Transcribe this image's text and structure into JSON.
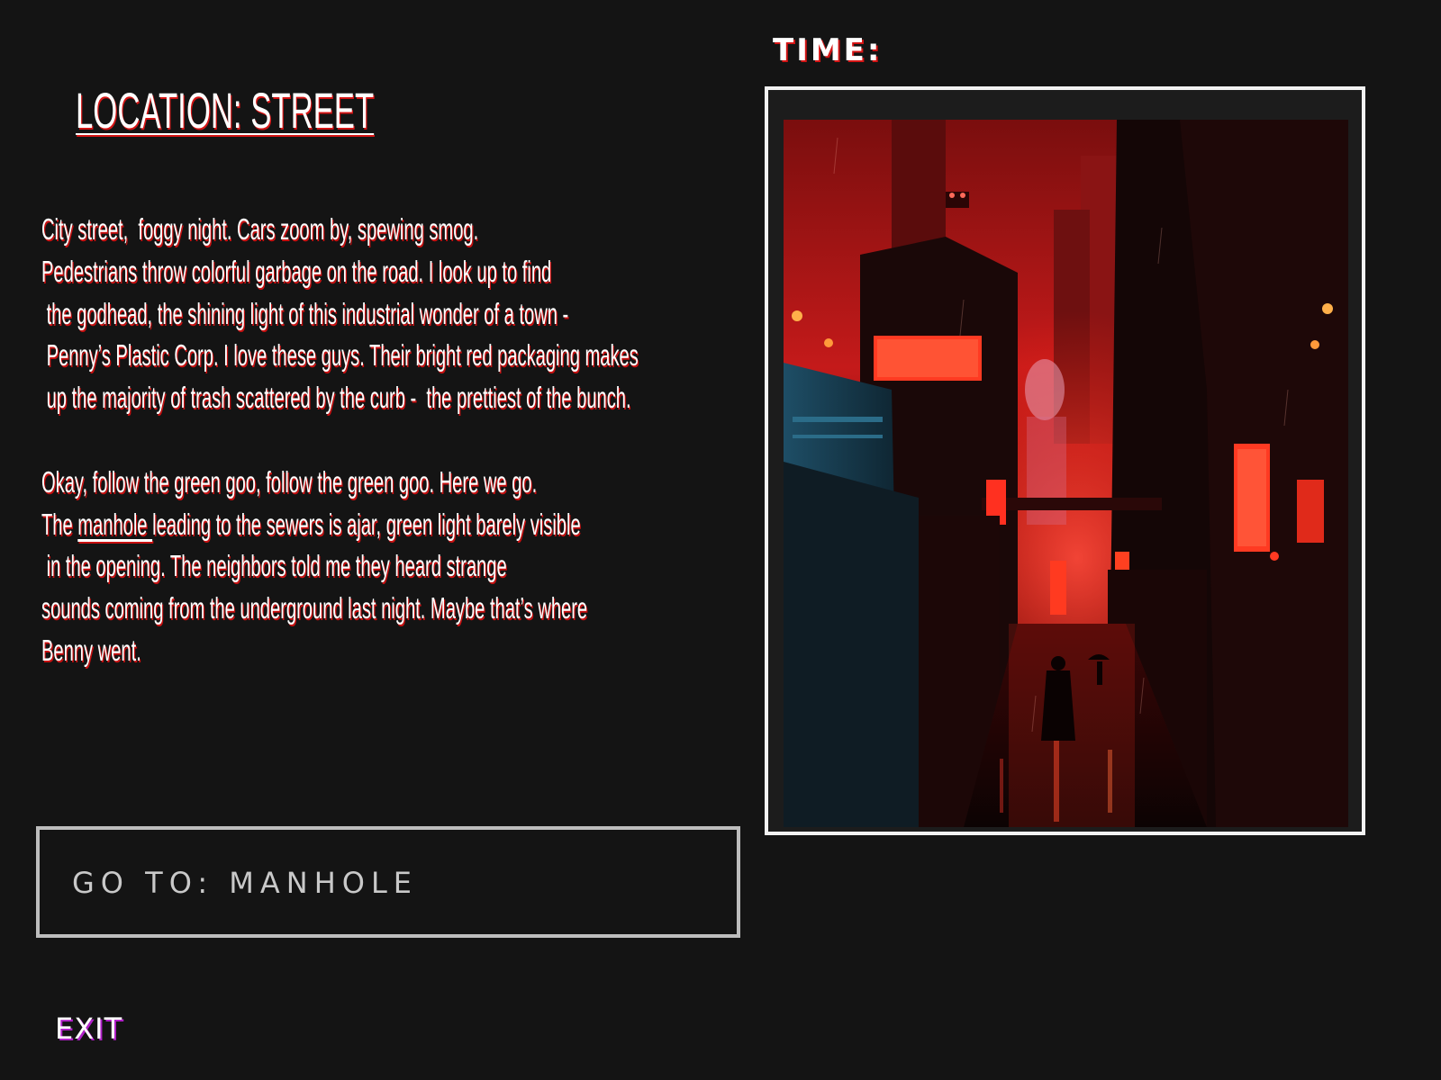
{
  "header": {
    "location_title": "LOCATION: STREET",
    "time_label": "TIME:",
    "time_value": ""
  },
  "narrative": {
    "paragraph_1": [
      "City street,  foggy night. Cars zoom by, spewing smog.",
      "Pedestrians throw colorful garbage on the road. I look up to find",
      " the godhead, the shining light of this industrial wonder of a town -",
      " Penny’s Plastic Corp. I love these guys. Their bright red packaging makes",
      " up the majority of trash scattered by the curb -  the prettiest of the bunch."
    ],
    "paragraph_2": {
      "line_1": "Okay, follow the green goo, follow the green goo. Here we go.",
      "line_2_before": "The ",
      "line_2_link": "manhole ",
      "line_2_after": "leading to the sewers is ajar, green light barely visible",
      "line_3": " in the opening. The neighbors told me they heard strange",
      "line_4": "sounds coming from the underground last night. Maybe that’s where",
      "line_5": "Benny went."
    }
  },
  "scene": {
    "icon": "cyberpunk-city-street-illustration",
    "colors": {
      "sky": "#c41a1a",
      "glow": "#ff3b2e",
      "teal": "#2f6f8a",
      "dark": "#120606"
    }
  },
  "actions": {
    "goto_label": "GO TO: MANHOLE",
    "exit_label": "EXIT"
  },
  "theme": {
    "background": "#141414",
    "text": "#ffffff",
    "accent_red": "#d41414",
    "accent_purple": "#b020c8",
    "box_border": "#bdbdbd"
  }
}
